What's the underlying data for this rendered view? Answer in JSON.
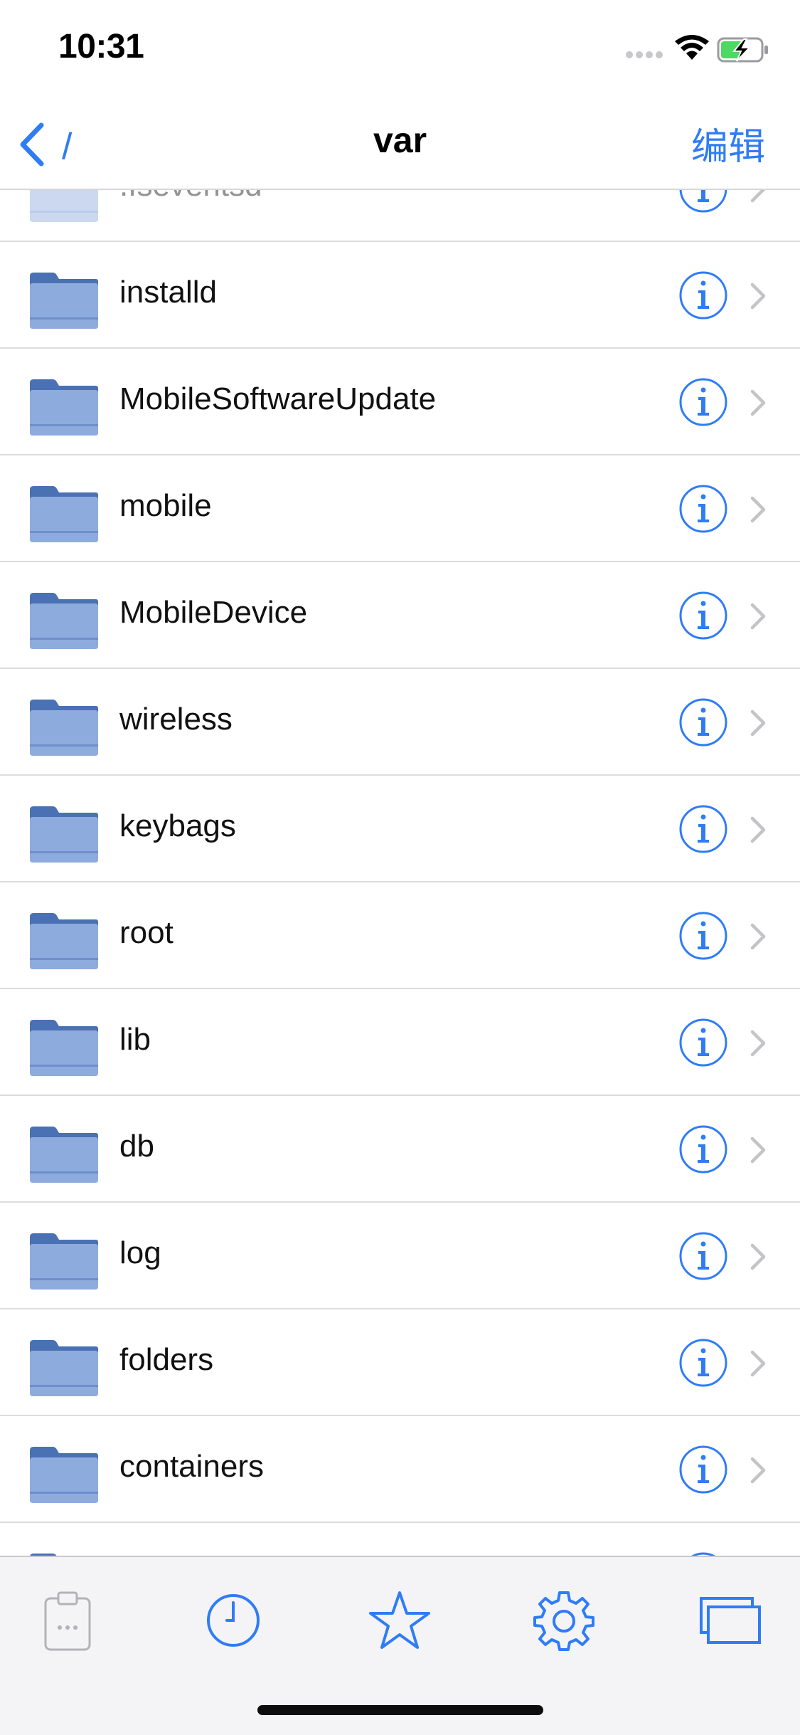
{
  "status_bar": {
    "time": "10:31",
    "icons": [
      "cellular-signal-icon",
      "wifi-icon",
      "battery-charging-icon"
    ]
  },
  "nav": {
    "back_label": "/",
    "title": "var",
    "edit_label": "编辑"
  },
  "list": {
    "items": [
      {
        "label": ".fseventsd"
      },
      {
        "label": "installd"
      },
      {
        "label": "MobileSoftwareUpdate"
      },
      {
        "label": "mobile"
      },
      {
        "label": "MobileDevice"
      },
      {
        "label": "wireless"
      },
      {
        "label": "keybags"
      },
      {
        "label": "root"
      },
      {
        "label": "lib"
      },
      {
        "label": "db"
      },
      {
        "label": "log"
      },
      {
        "label": "folders"
      },
      {
        "label": "containers"
      },
      {
        "label": ""
      }
    ]
  },
  "tab_bar": {
    "tabs": [
      "clipboard-icon",
      "clock-icon",
      "star-icon",
      "gear-icon",
      "windows-icon"
    ]
  },
  "colors": {
    "accent": "#2f7cf6",
    "folder_body": "#8eabde",
    "folder_back": "#4a71b3",
    "separator": "#dcdcdf",
    "chevron": "#c4c4c8"
  }
}
